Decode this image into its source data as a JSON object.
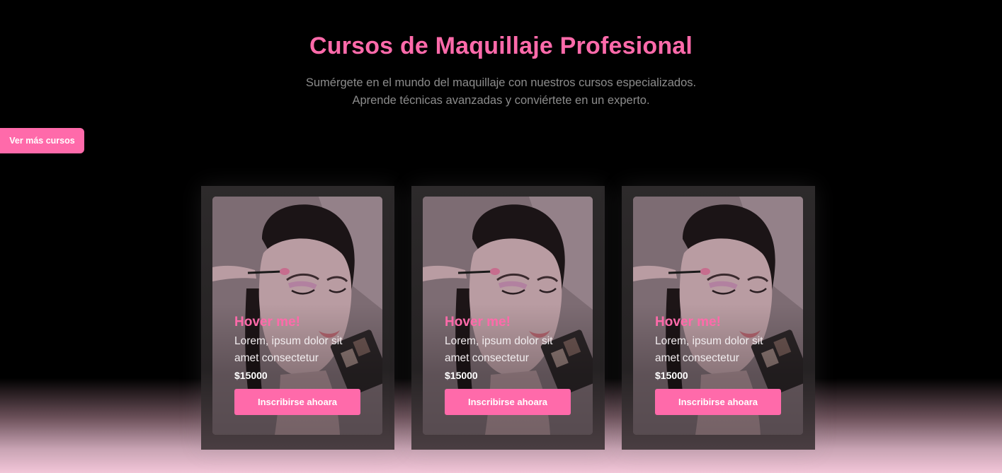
{
  "header": {
    "title": "Cursos de Maquillaje Profesional",
    "subtitle_line1": "Sumérgete en el mundo del maquillaje con nuestros cursos especializados.",
    "subtitle_line2": "Aprende técnicas avanzadas y conviértete en un experto."
  },
  "more_courses_label": "Ver más cursos",
  "colors": {
    "accent": "#ff6aaa",
    "background": "#000000",
    "subtitle": "#8c8c8c"
  },
  "cards": [
    {
      "heading": "Hover me!",
      "text_line1": "Lorem, ipsum dolor sit",
      "text_line2": "amet consectetur",
      "price": "$15000",
      "button_label": "Inscribirse ahoara"
    },
    {
      "heading": "Hover me!",
      "text_line1": "Lorem, ipsum dolor sit",
      "text_line2": "amet consectetur",
      "price": "$15000",
      "button_label": "Inscribirse ahoara"
    },
    {
      "heading": "Hover me!",
      "text_line1": "Lorem, ipsum dolor sit",
      "text_line2": "amet consectetur",
      "price": "$15000",
      "button_label": "Inscribirse ahoara"
    }
  ]
}
